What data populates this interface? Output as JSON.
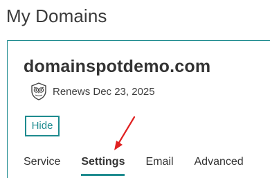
{
  "page": {
    "title": "My Domains"
  },
  "domain": {
    "name": "domainspotdemo.com",
    "renewal_text": "Renews Dec 23, 2025"
  },
  "actions": {
    "hide_label": "Hide"
  },
  "tabs": [
    {
      "label": "Service",
      "active": false
    },
    {
      "label": "Settings",
      "active": true
    },
    {
      "label": "Email",
      "active": false
    },
    {
      "label": "Advanced",
      "active": false
    }
  ],
  "colors": {
    "accent": "#1e8b8f",
    "text": "#333333",
    "annotation": "#e02020"
  },
  "icons": {
    "renewal": "shield-owl-icon",
    "annotation": "red-arrow-icon"
  }
}
